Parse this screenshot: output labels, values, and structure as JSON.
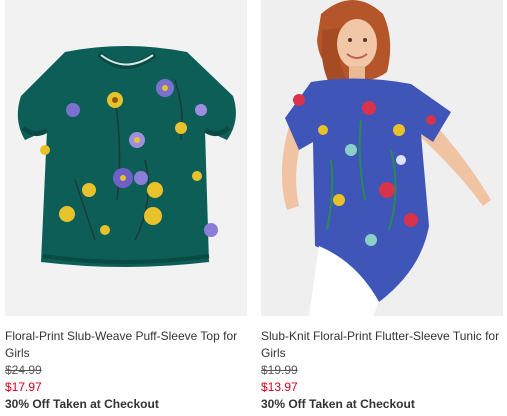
{
  "products": [
    {
      "name": "Floral-Print Slub-Weave Puff-Sleeve Top for Girls",
      "image_alt": "teal floral puff-sleeve top",
      "original_price": "$24.99",
      "sale_price": "$17.97",
      "promo": "30% Off Taken at Checkout",
      "colors": {
        "garment": "#0e5e58",
        "background": "#f2f2f2"
      }
    },
    {
      "name": "Slub-Knit Floral-Print Flutter-Sleeve Tunic for Girls",
      "image_alt": "girl wearing blue floral flutter-sleeve tunic",
      "original_price": "$19.99",
      "sale_price": "$13.97",
      "promo": "30% Off Taken at Checkout",
      "colors": {
        "garment": "#3f55b8",
        "background": "#efefef"
      }
    }
  ],
  "colors": {
    "sale": "#d0021b",
    "text": "#333333"
  }
}
